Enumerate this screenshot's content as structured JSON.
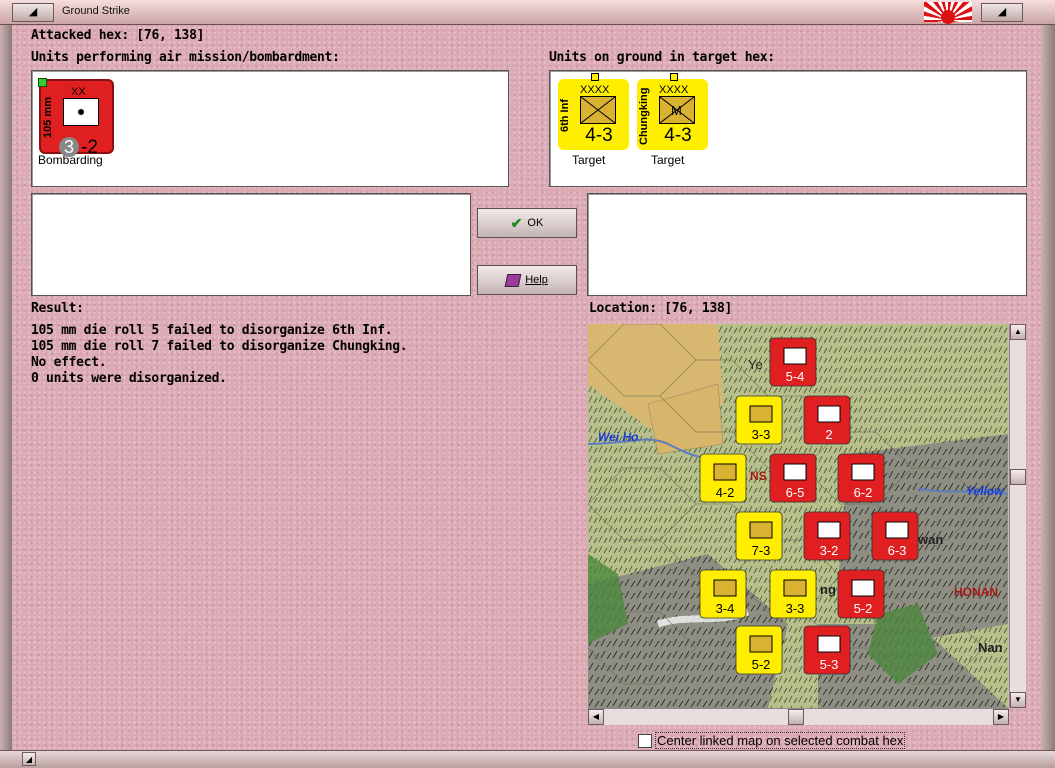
{
  "window": {
    "title": "Ground Strike"
  },
  "header": {
    "attacked_hex_label": "Attacked hex:",
    "attacked_hex_value": "[76, 138]"
  },
  "air_units": {
    "heading": "Units performing air mission/bombardment:",
    "units": [
      {
        "side_text": "105 mm",
        "size": "XX",
        "attack": "3",
        "defense": "2",
        "status": "Bombarding",
        "color": "#e02020"
      }
    ]
  },
  "ground_units": {
    "heading": "Units on ground in target hex:",
    "units": [
      {
        "side_text": "6th Inf",
        "size": "XXXX",
        "strength": "4-3",
        "status": "Target",
        "color": "#ffee00"
      },
      {
        "side_text": "Chungking",
        "size": "XXXX",
        "strength": "4-3",
        "status": "Target",
        "color": "#ffee00",
        "mark": "M"
      }
    ]
  },
  "buttons": {
    "ok": "OK",
    "help": "Help"
  },
  "result": {
    "heading": "Result:",
    "lines": [
      "105 mm die roll 5 failed to disorganize 6th Inf.",
      "105 mm die roll 7 failed to disorganize Chungking.",
      "No effect.",
      "0 units were disorganized."
    ]
  },
  "location": {
    "label": "Location:",
    "value": "[76, 138]"
  },
  "map": {
    "place_names": [
      "Wei Ho",
      "Yellow",
      "Ye",
      "wan",
      "ng",
      "HONAN",
      "Nan",
      "NS"
    ],
    "counters": [
      {
        "strength": "5-4",
        "color": "#e02020"
      },
      {
        "strength": "3-3",
        "color": "#ffee00"
      },
      {
        "strength": "2",
        "color": "#e02020"
      },
      {
        "strength": "4-2",
        "color": "#ffee00"
      },
      {
        "strength": "6-5",
        "color": "#e02020"
      },
      {
        "strength": "6-2",
        "color": "#e02020"
      },
      {
        "strength": "7-3",
        "color": "#ffee00"
      },
      {
        "strength": "3-2",
        "color": "#e02020"
      },
      {
        "strength": "6-3",
        "color": "#e02020"
      },
      {
        "strength": "3-4",
        "color": "#ffee00"
      },
      {
        "strength": "3-3",
        "color": "#ffee00"
      },
      {
        "strength": "5-2",
        "color": "#e02020"
      },
      {
        "strength": "5-2",
        "color": "#ffee00"
      },
      {
        "strength": "5-3",
        "color": "#e02020"
      }
    ]
  },
  "options": {
    "center_map_label": "Center linked map on selected combat hex"
  }
}
